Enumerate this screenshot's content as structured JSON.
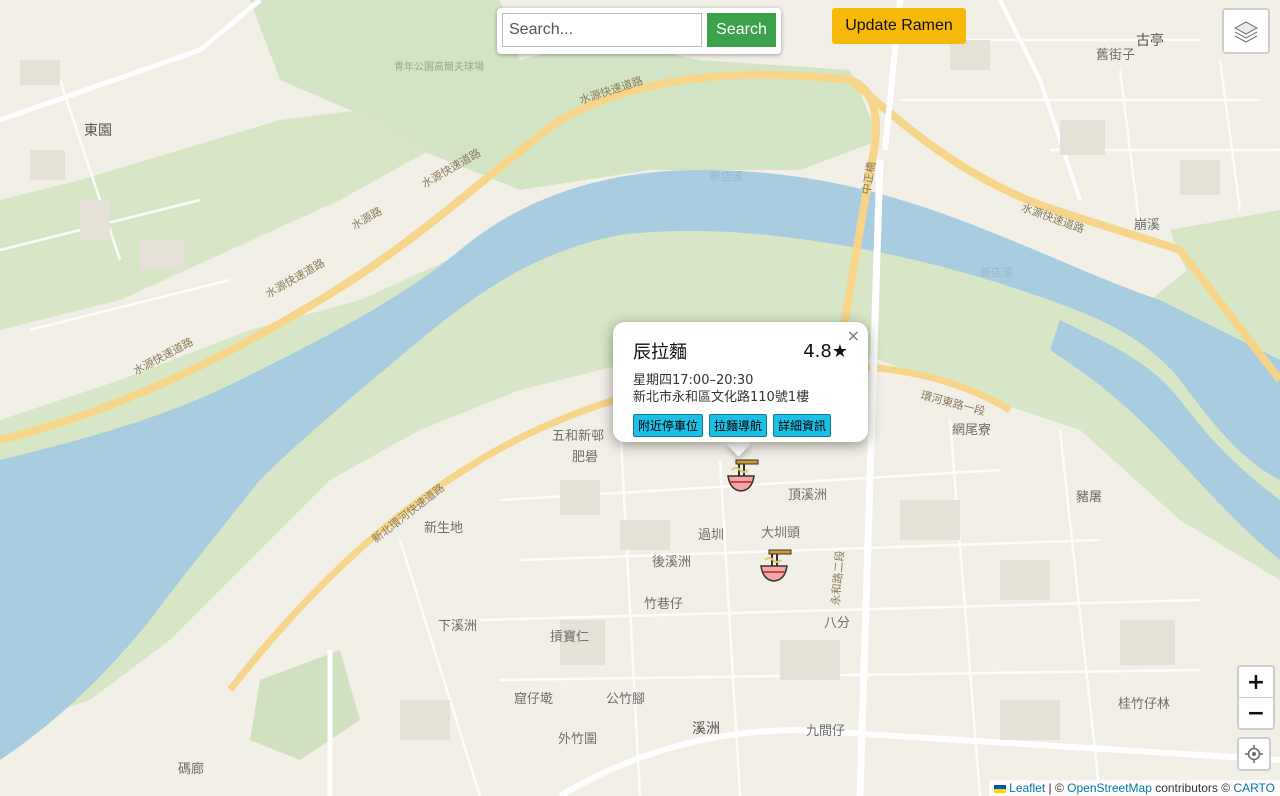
{
  "search": {
    "placeholder": "Search...",
    "button_label": "Search"
  },
  "update_button_label": "Update Ramen",
  "zoom": {
    "in_label": "+",
    "out_label": "−"
  },
  "attribution": {
    "prefix": "Leaflet",
    "separator": " | © ",
    "osm": "OpenStreetMap",
    "contrib": " contributors © ",
    "carto": "CARTO"
  },
  "popup": {
    "name": "辰拉麵",
    "rating": "4.8★",
    "hours": "星期四17:00–20:30",
    "address": "新北市永和區文化路110號1樓",
    "close_label": "×",
    "buttons": [
      "附近停車位",
      "拉麵導航",
      "詳細資訊"
    ]
  },
  "map_labels": {
    "dongyuan": "東園",
    "guting": "古亭",
    "qiaojie": "舊街子",
    "wuhe_xincun": "五和新邨",
    "feiliao": "肥礐",
    "dingxizhou": "頂溪洲",
    "xinshengdi": "新生地",
    "guozhou": "過圳",
    "dazhenjue": "大圳頭",
    "houxizhou": "後溪洲",
    "zhuxiangzi": "竹巷仔",
    "xiaxizhou": "下溪洲",
    "guibaoren": "摃寶仁",
    "bafen": "八分",
    "wangweiliao": "網尾寮",
    "zhuliao": "豬屠",
    "chongxi": "崩溪",
    "guizhuzailin": "桂竹仔林",
    "wozaitou": "窟仔墘",
    "gongzhujiao": "公竹腳",
    "waizhuwei": "外竹圍",
    "xizhou": "溪洲",
    "jiujianzai": "九間仔",
    "shilang": "碼廊",
    "shuiyuan_kuaisu": "水源快速道路",
    "shuiyuan_road": "水源路",
    "xinbei_huanhe": "新北環河快速道路",
    "huanhe_east": "環河東路一段",
    "zhongzheng_bridge": "中正橋",
    "yonghe_road": "永和路二段",
    "xindian_river": "新店溪",
    "qingnian_park": "青年公園高爾夫球場"
  }
}
